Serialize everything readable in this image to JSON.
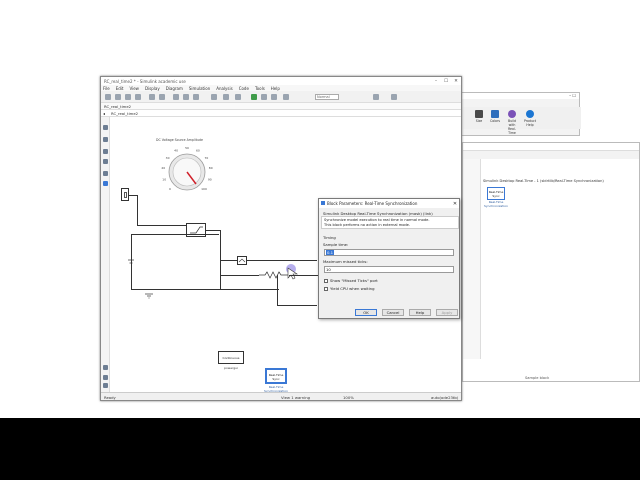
{
  "main_window": {
    "title": "RC_real_time2 * - Simulink academic use",
    "menu": [
      "File",
      "Edit",
      "View",
      "Display",
      "Diagram",
      "Simulation",
      "Analysis",
      "Code",
      "Tools",
      "Help"
    ],
    "stop_time": "Normal",
    "tab": "RC_real_time2",
    "breadcrumb": "RC_real_time2",
    "status_left": "Ready",
    "status_mid": "View 1 warning",
    "status_zoom": "100%",
    "status_right": "auto(ode23tb)"
  },
  "knob": {
    "title": "DC Voltage Source Amplitude",
    "ticks": [
      "0",
      "10",
      "20",
      "30",
      "40",
      "50",
      "60",
      "70",
      "80",
      "90",
      "100"
    ]
  },
  "blocks": {
    "continuous_label": "Continuous",
    "powergui_label": "powergui",
    "rts_block_text": "Real-Time Sync",
    "rts_label": "Real-Time Synchronization"
  },
  "library_browser": {
    "toolbar": [
      {
        "label": "Size",
        "color": "#4a4a4a"
      },
      {
        "label": "Colors",
        "color": "#2f6ebc"
      },
      {
        "label": "Build with Real-Time",
        "color": "#7b52b8"
      },
      {
        "label": "Product Help",
        "color": "#1c76d2"
      }
    ],
    "tree_header": "Simulink Desktop Real-Time - 1 (sldrtlib/Real-Time Synchronization)",
    "block_text": "Real-Time Sync",
    "block_label": "Real-Time Synchronization",
    "bottom_text": "Sample block"
  },
  "dialog": {
    "title": "Block Parameters: Real-Time Synchronization",
    "header": "Simulink Desktop Real-Time Synchronization (mask) (link)",
    "description_1": "Synchronize model execution to real time in normal mode.",
    "description_2": "This block performs no action in external mode.",
    "group": "Timing",
    "sample_time_label": "Sample time:",
    "sample_time_value": "0.1",
    "max_missed_label": "Maximum missed ticks:",
    "max_missed_value": "10",
    "show_missed_ticks": "Show \"Missed Ticks\" port",
    "yield_cpu": "Yield CPU when waiting",
    "buttons": {
      "ok": "OK",
      "cancel": "Cancel",
      "help": "Help",
      "apply": "Apply"
    }
  },
  "colors": {
    "accent": "#3a78d5",
    "knob_pointer": "#d0202a",
    "cursor_highlight": "#7b6ee0"
  }
}
